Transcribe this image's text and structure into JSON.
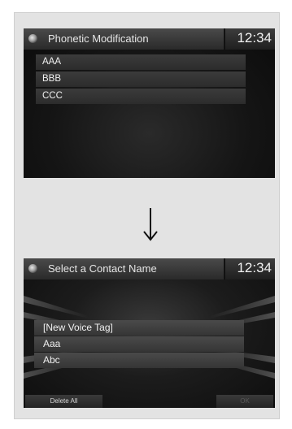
{
  "screen1": {
    "title": "Phonetic Modification",
    "clock": "12:34",
    "items": [
      {
        "label": "AAA"
      },
      {
        "label": "BBB"
      },
      {
        "label": "CCC"
      }
    ]
  },
  "screen2": {
    "title": "Select a Contact Name",
    "clock": "12:34",
    "items": [
      {
        "label": "[New Voice Tag]"
      },
      {
        "label": "Aaa"
      },
      {
        "label": "Abc"
      }
    ],
    "footer": {
      "delete_all": "Delete All",
      "ok": "OK"
    }
  },
  "icons": {
    "menu": "menu-orb-icon",
    "arrow": "arrow-down-icon"
  },
  "colors": {
    "panel_bg": "#e3e3e3",
    "screen_bg": "#141414",
    "text": "#f0f0f0"
  }
}
